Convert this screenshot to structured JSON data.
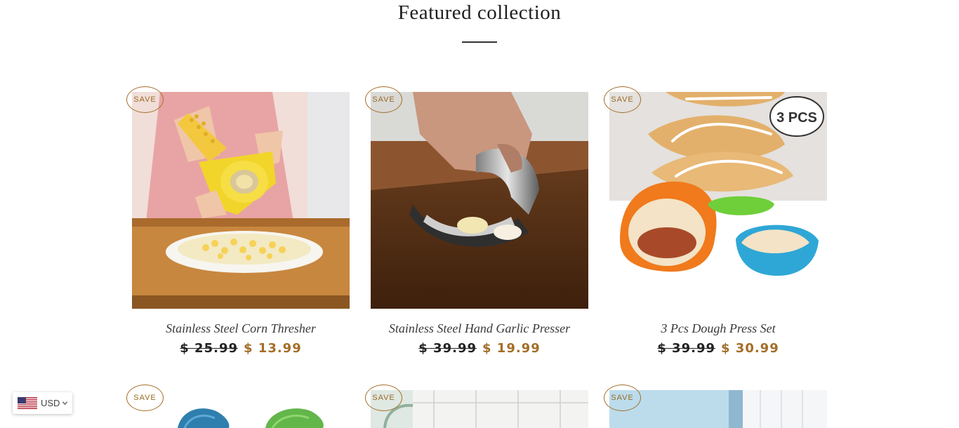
{
  "section": {
    "title": "Featured collection"
  },
  "badge_label": "SAVE",
  "products": [
    {
      "name": "Stainless Steel Corn Thresher",
      "old_price": "$ 25.99",
      "new_price": "$ 13.99"
    },
    {
      "name": "Stainless Steel Hand Garlic Presser",
      "old_price": "$ 39.99",
      "new_price": "$ 19.99"
    },
    {
      "name": "3 Pcs Dough Press Set",
      "old_price": "$ 39.99",
      "new_price": "$ 30.99",
      "image_text": "3 PCS"
    }
  ],
  "currency": {
    "code": "USD",
    "flag_icon": "us-flag-icon"
  },
  "colors": {
    "accent": "#a36e28",
    "text": "#222222"
  }
}
